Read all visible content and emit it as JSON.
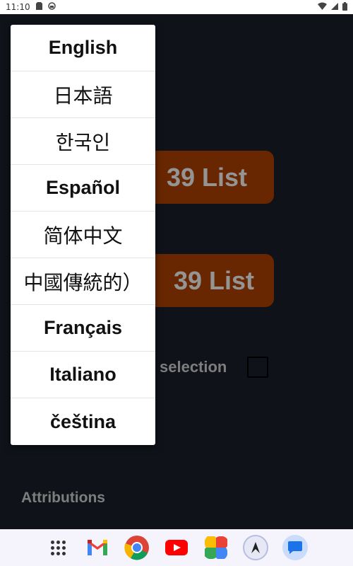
{
  "status_bar": {
    "time": "11:10"
  },
  "background": {
    "button_1_label": "39 List",
    "button_2_label": "39 List",
    "selection_label": "selection",
    "attributions_label": "Attributions",
    "button_color": "#b34400"
  },
  "language_menu": {
    "items": [
      {
        "label": "English"
      },
      {
        "label": "日本語"
      },
      {
        "label": "한국인"
      },
      {
        "label": "Español"
      },
      {
        "label": "简体中文"
      },
      {
        "label": "中國傳統的）"
      },
      {
        "label": "Français"
      },
      {
        "label": "Italiano"
      },
      {
        "label": "čeština"
      }
    ]
  },
  "dock": {
    "icons": [
      "app-drawer-icon",
      "gmail-icon",
      "chrome-icon",
      "youtube-icon",
      "photos-icon",
      "custom-app-icon",
      "messages-icon"
    ]
  }
}
